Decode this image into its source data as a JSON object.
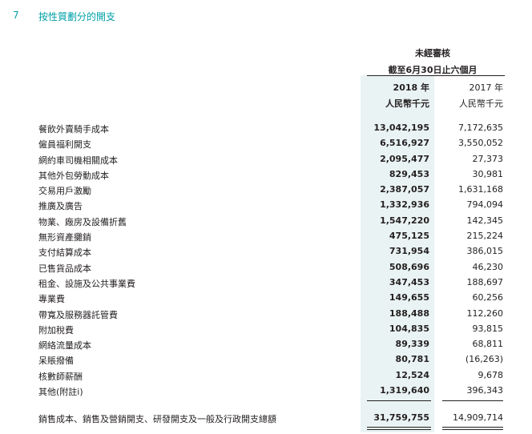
{
  "section": {
    "number": "7",
    "title": "按性質劃分的開支"
  },
  "header": {
    "unaudited": "未經審核",
    "period": "截至6月30日止六個月",
    "col_2018_year": "2018 年",
    "col_2018_unit": "人民幣千元",
    "col_2017_year": "2017 年",
    "col_2017_unit": "人民幣千元"
  },
  "rows": [
    {
      "label": "餐飲外賣騎手成本",
      "v2018": "13,042,195",
      "v2017": "7,172,635"
    },
    {
      "label": "僱員福利開支",
      "v2018": "6,516,927",
      "v2017": "3,550,052"
    },
    {
      "label": "網約車司機相關成本",
      "v2018": "2,095,477",
      "v2017": "27,373"
    },
    {
      "label": "其他外包勞動成本",
      "v2018": "829,453",
      "v2017": "30,981"
    },
    {
      "label": "交易用戶激勵",
      "v2018": "2,387,057",
      "v2017": "1,631,168"
    },
    {
      "label": "推廣及廣告",
      "v2018": "1,332,936",
      "v2017": "794,094"
    },
    {
      "label": "物業、廠房及設備折舊",
      "v2018": "1,547,220",
      "v2017": "142,345"
    },
    {
      "label": "無形資產攤銷",
      "v2018": "475,125",
      "v2017": "215,224"
    },
    {
      "label": "支付結算成本",
      "v2018": "731,954",
      "v2017": "386,015"
    },
    {
      "label": "已售貨品成本",
      "v2018": "508,696",
      "v2017": "46,230"
    },
    {
      "label": "租金、設施及公共事業費",
      "v2018": "347,453",
      "v2017": "188,697"
    },
    {
      "label": "專業費",
      "v2018": "149,655",
      "v2017": "60,256"
    },
    {
      "label": "帶寬及服務器託管費",
      "v2018": "188,488",
      "v2017": "112,260"
    },
    {
      "label": "附加稅費",
      "v2018": "104,835",
      "v2017": "93,815"
    },
    {
      "label": "網絡流量成本",
      "v2018": "89,339",
      "v2017": "68,811"
    },
    {
      "label": "呆賬撥備",
      "v2018": "80,781",
      "v2017": "(16,263)"
    },
    {
      "label": "核數師薪酬",
      "v2018": "12,524",
      "v2017": "9,678"
    },
    {
      "label": "其他(附註i)",
      "v2018": "1,319,640",
      "v2017": "396,343"
    }
  ],
  "total": {
    "label": "銷售成本、銷售及營銷開支、研發開支及一般及行政開支總額",
    "v2018": "31,759,755",
    "v2017": "14,909,714"
  }
}
